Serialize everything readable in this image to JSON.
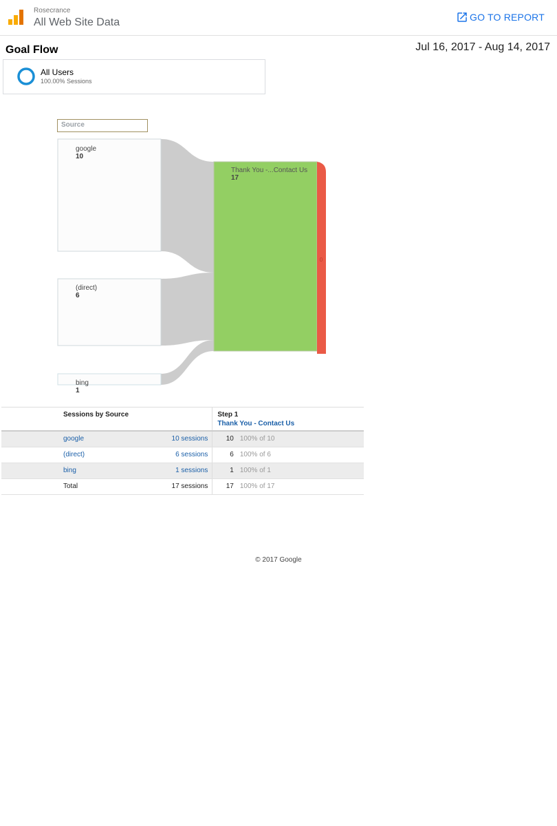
{
  "header": {
    "account": "Rosecrance",
    "property": "All Web Site Data",
    "go_to_report": "GO TO REPORT"
  },
  "report": {
    "title": "Goal Flow",
    "date_range": "Jul 16, 2017 - Aug 14, 2017"
  },
  "segment": {
    "name": "All Users",
    "sessions_pct": "100.00% Sessions"
  },
  "flow": {
    "dimension_label": "Source",
    "sources": [
      {
        "name": "google",
        "value": "10"
      },
      {
        "name": "(direct)",
        "value": "6"
      },
      {
        "name": "bing",
        "value": "1"
      }
    ],
    "goal": {
      "name": "Thank You -...Contact Us",
      "value": "17"
    },
    "exit_value": "0",
    "colors": {
      "goal": "#93cf63",
      "exit": "#ea5a46",
      "link": "#cccccc",
      "source_border": "#cfd8dc"
    }
  },
  "table": {
    "col1_header": "Sessions by Source",
    "col2_header": "Step 1",
    "col2_subheader": "Thank You - Contact Us",
    "rows": [
      {
        "source": "google",
        "sessions": "10 sessions",
        "step": "10",
        "pct": "100% of 10"
      },
      {
        "source": "(direct)",
        "sessions": "6 sessions",
        "step": "6",
        "pct": "100% of 6"
      },
      {
        "source": "bing",
        "sessions": "1 sessions",
        "step": "1",
        "pct": "100% of 1"
      }
    ],
    "total": {
      "label": "Total",
      "sessions": "17 sessions",
      "step": "17",
      "pct": "100% of 17"
    }
  },
  "footer": {
    "copyright": "© 2017 Google"
  }
}
